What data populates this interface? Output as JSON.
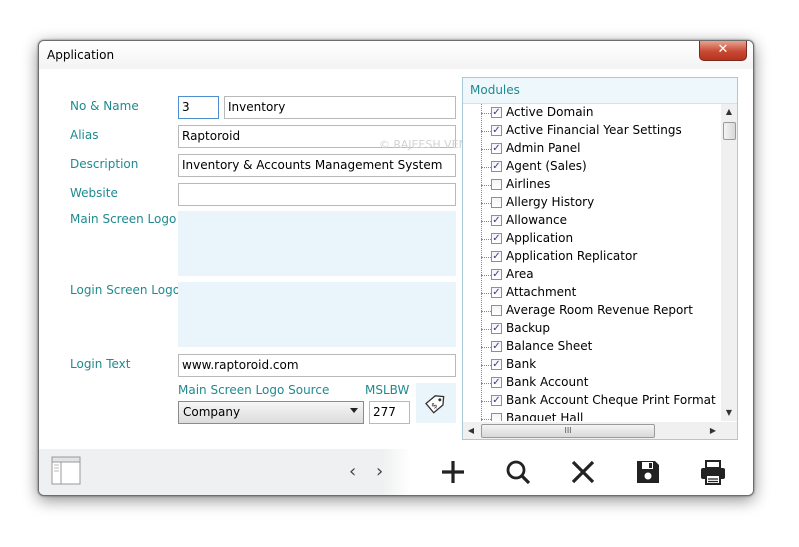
{
  "window": {
    "title": "Application",
    "close_label": "✕"
  },
  "form": {
    "no_name_label": "No & Name",
    "no_value": "3",
    "name_value": "Inventory",
    "alias_label": "Alias",
    "alias_value": "Raptoroid",
    "description_label": "Description",
    "description_value": "Inventory & Accounts Management System",
    "website_label": "Website",
    "website_value": "",
    "main_logo_label": "Main Screen Logo",
    "login_logo_label": "Login Screen Logo",
    "login_text_label": "Login Text",
    "login_text_value": "www.raptoroid.com",
    "logo_source_label": "Main Screen Logo Source",
    "logo_source_value": "Company",
    "mslbw_label": "MSLBW",
    "mslbw_value": "277"
  },
  "watermark": "© RAJEESH VENGALAPURATH",
  "modules": {
    "title": "Modules",
    "items": [
      {
        "label": "Active Domain",
        "checked": true
      },
      {
        "label": "Active Financial Year Settings",
        "checked": true
      },
      {
        "label": "Admin Panel",
        "checked": true
      },
      {
        "label": "Agent (Sales)",
        "checked": true
      },
      {
        "label": "Airlines",
        "checked": false
      },
      {
        "label": "Allergy History",
        "checked": false
      },
      {
        "label": "Allowance",
        "checked": true
      },
      {
        "label": "Application",
        "checked": true
      },
      {
        "label": "Application Replicator",
        "checked": true
      },
      {
        "label": "Area",
        "checked": true
      },
      {
        "label": "Attachment",
        "checked": true
      },
      {
        "label": "Average Room Revenue Report",
        "checked": false
      },
      {
        "label": "Backup",
        "checked": true
      },
      {
        "label": "Balance Sheet",
        "checked": true
      },
      {
        "label": "Bank",
        "checked": true
      },
      {
        "label": "Bank Account",
        "checked": true
      },
      {
        "label": "Bank Account Cheque Print Format",
        "checked": true
      },
      {
        "label": "Banquet Hall",
        "checked": false
      }
    ],
    "hscroll_grip": "III"
  },
  "toolbar": {
    "prev_glyph": "‹",
    "next_glyph": "›"
  },
  "colors": {
    "label": "#1f8a8f",
    "logo_area": "#eaf5fb",
    "close": "#c74a34"
  }
}
